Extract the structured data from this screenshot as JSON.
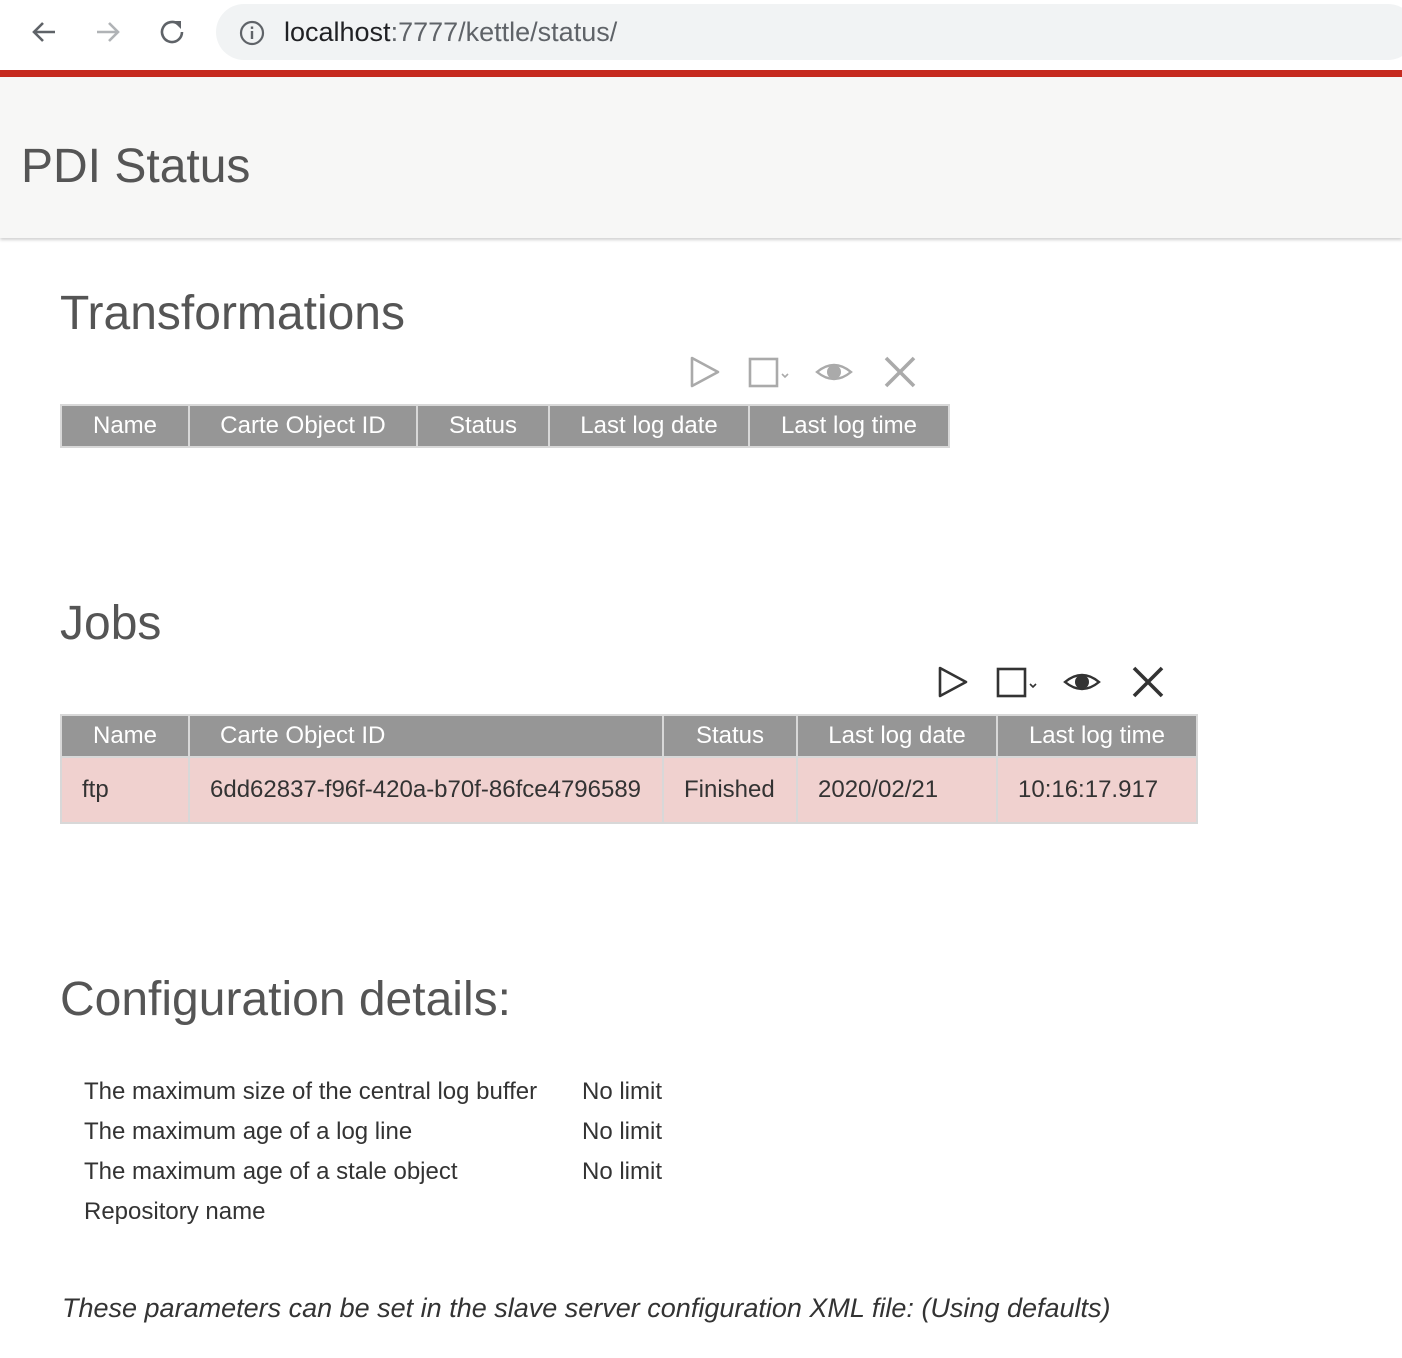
{
  "browser": {
    "url_host": "localhost",
    "url_path": ":7777/kettle/status/"
  },
  "header": {
    "title": "PDI Status"
  },
  "transformations": {
    "title": "Transformations",
    "columns": [
      "Name",
      "Carte Object ID",
      "Status",
      "Last log date",
      "Last log time"
    ],
    "rows": []
  },
  "jobs": {
    "title": "Jobs",
    "columns": [
      "Name",
      "Carte Object ID",
      "Status",
      "Last log date",
      "Last log time"
    ],
    "rows": [
      {
        "name": "ftp",
        "id": "6dd62837-f96f-420a-b70f-86fce4796589",
        "status": "Finished",
        "date": "2020/02/21",
        "time": "10:16:17.917"
      }
    ]
  },
  "config": {
    "title": "Configuration details:",
    "items": [
      {
        "label": "The maximum size of the central log buffer",
        "value": "No limit"
      },
      {
        "label": "The maximum age of a log line",
        "value": "No limit"
      },
      {
        "label": "The maximum age of a stale object",
        "value": "No limit"
      },
      {
        "label": "Repository name",
        "value": ""
      }
    ],
    "footnote": "These parameters can be set in the slave server configuration XML file: (Using defaults)"
  },
  "icons": {
    "toolbar": [
      "play-icon",
      "stop-icon",
      "view-icon",
      "remove-icon"
    ],
    "accent_red": "#c62a1f",
    "header_gray": "#969696",
    "row_highlight": "#f0d1cf"
  }
}
